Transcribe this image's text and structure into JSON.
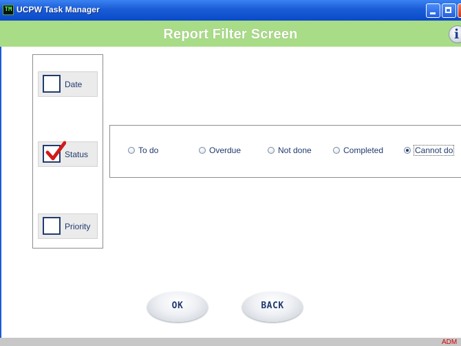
{
  "window": {
    "app_icon_text": "TM",
    "title": "UCPW Task Manager"
  },
  "header": {
    "title": "Report Filter Screen",
    "info_icon": "i"
  },
  "filters": [
    {
      "label": "Date",
      "checked": false
    },
    {
      "label": "Status",
      "checked": true
    },
    {
      "label": "Priority",
      "checked": false
    }
  ],
  "status_options": [
    {
      "label": "To do",
      "selected": false
    },
    {
      "label": "Overdue",
      "selected": false
    },
    {
      "label": "Not done",
      "selected": false
    },
    {
      "label": "Completed",
      "selected": false
    },
    {
      "label": "Cannot do",
      "selected": true
    }
  ],
  "buttons": {
    "ok": "OK",
    "back": "BACK"
  },
  "statusbar": {
    "user": "ADM"
  },
  "colors": {
    "header_bg": "#a9dc87",
    "text_navy": "#1f3a6e",
    "check_red": "#d11a1a",
    "user_red": "#d40000"
  }
}
